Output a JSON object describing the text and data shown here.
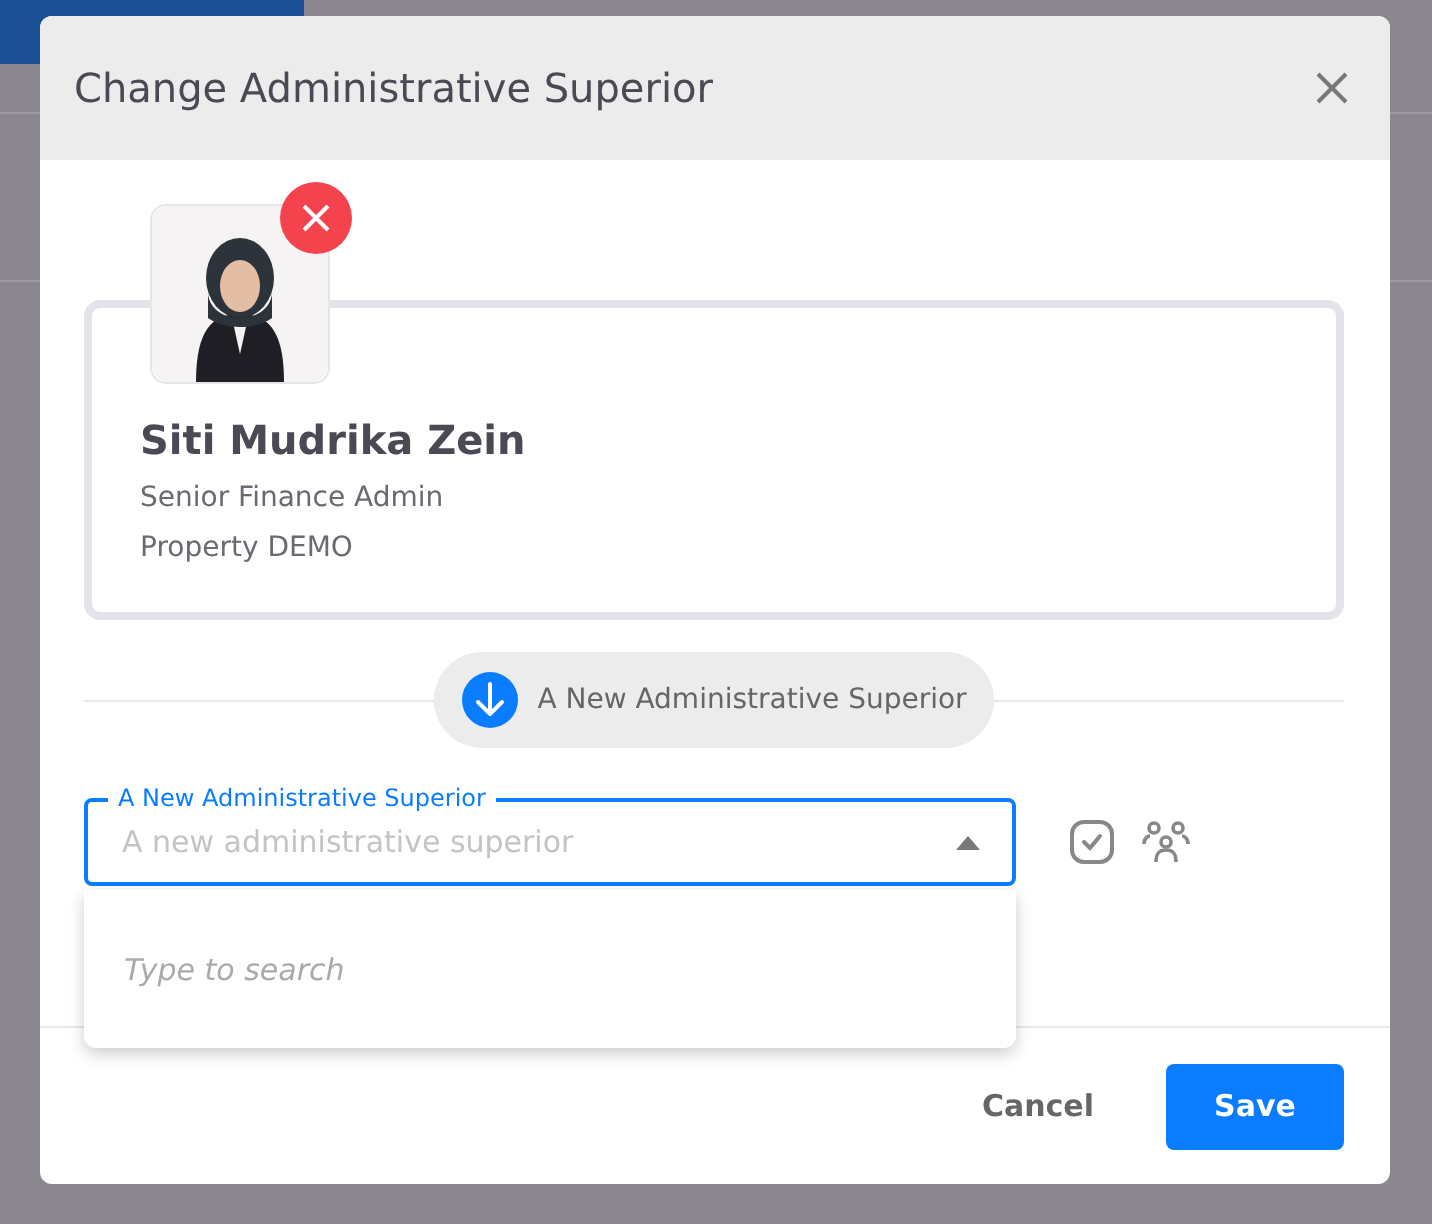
{
  "dialog": {
    "title": "Change Administrative Superior"
  },
  "person": {
    "name": "Siti Mudrika Zein",
    "role": "Senior Finance Admin",
    "property": "Property DEMO"
  },
  "section_label": "A New Administrative Superior",
  "field": {
    "label": "A New Administrative Superior",
    "placeholder": "A new administrative superior",
    "focused": true
  },
  "dropdown": {
    "open": true,
    "hint": "Type to search"
  },
  "buttons": {
    "cancel": "Cancel",
    "save": "Save"
  }
}
